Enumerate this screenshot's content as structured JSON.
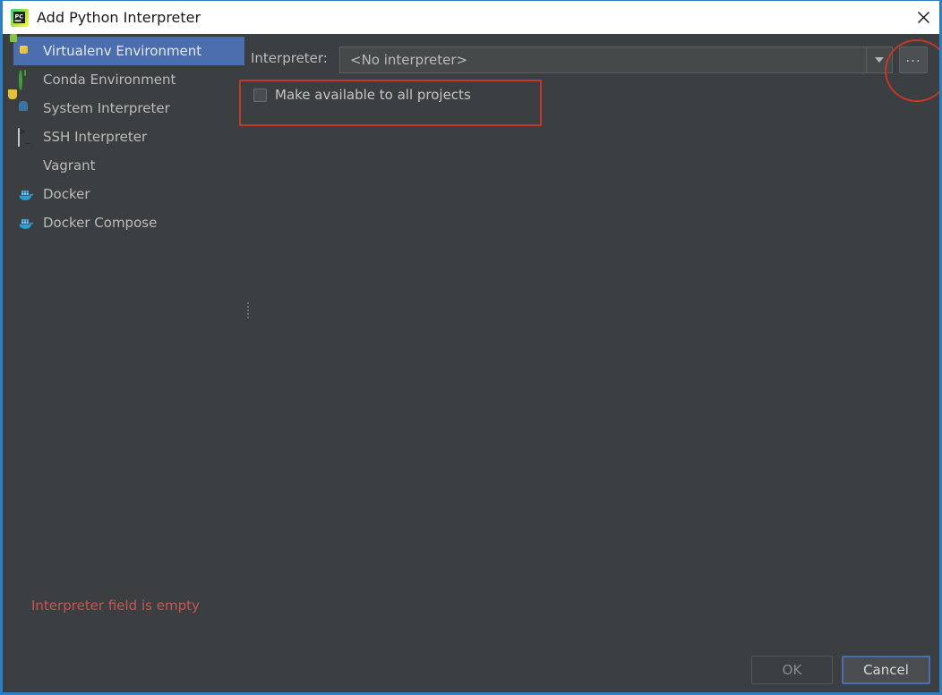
{
  "window": {
    "title": "Add Python Interpreter",
    "app_icon": "pycharm-icon",
    "close_icon": "close-icon",
    "accent_color": "#2d7fc1",
    "background_color": "#3c3f41"
  },
  "sidebar": {
    "items": [
      {
        "label": "Virtualenv Environment",
        "icon": "virtualenv-icon",
        "selected": true
      },
      {
        "label": "Conda Environment",
        "icon": "conda-icon",
        "selected": false
      },
      {
        "label": "System Interpreter",
        "icon": "python-icon",
        "selected": false
      },
      {
        "label": "SSH Interpreter",
        "icon": "terminal-icon",
        "selected": false
      },
      {
        "label": "Vagrant",
        "icon": "vagrant-icon",
        "selected": false
      },
      {
        "label": "Docker",
        "icon": "docker-whale-icon",
        "selected": false
      },
      {
        "label": "Docker Compose",
        "icon": "docker-whale-icon",
        "selected": false
      }
    ],
    "selection_color": "#4b6eaf"
  },
  "main": {
    "interpreter_label": "Interpreter:",
    "interpreter_value": "<No interpreter>",
    "dropdown_icon": "chevron-down-icon",
    "browse_button_label": "...",
    "make_available_label": "Make available to all projects",
    "make_available_checked": false,
    "highlight_color": "#c0392b"
  },
  "status": {
    "error_message": "Interpreter field is empty",
    "error_color": "#c75450"
  },
  "footer": {
    "ok_label": "OK",
    "ok_enabled": false,
    "cancel_label": "Cancel",
    "cancel_focused": true
  }
}
